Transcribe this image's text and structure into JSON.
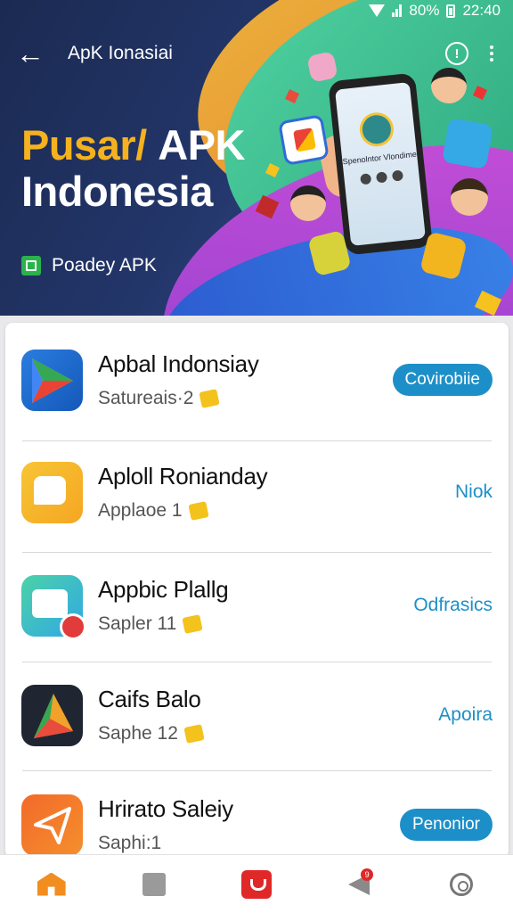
{
  "status": {
    "battery": "80%",
    "time": "22:40"
  },
  "topbar": {
    "title": "ApK Ionasiai"
  },
  "hero": {
    "title_part1": "Pusar/",
    "title_part2": "APK",
    "title_line2": "Indonesia",
    "subtitle": "Poadey APK",
    "phone_screen_text": "Spenolntor Vlondime"
  },
  "apps": [
    {
      "name": "Apbal Indonsiay",
      "sub": "Satureais·2",
      "action": "Covirobiie",
      "action_style": "pill"
    },
    {
      "name": "Aploll Ronianday",
      "sub": "Applaoe 1",
      "action": "Niok",
      "action_style": "text"
    },
    {
      "name": "Appbic Plallg",
      "sub": "Sapler 11",
      "action": "Odfrasics",
      "action_style": "text"
    },
    {
      "name": "Caifs Balo",
      "sub": "Saphe 12",
      "action": "Apoira",
      "action_style": "text"
    },
    {
      "name": "Hrirato Saleiy",
      "sub": "Saphi:1",
      "action": "Penonior",
      "action_style": "pill"
    }
  ],
  "bottom_nav": {
    "items": [
      {
        "icon": "home-icon"
      },
      {
        "icon": "square-icon"
      },
      {
        "icon": "store-icon"
      },
      {
        "icon": "send-icon",
        "badge": "9"
      },
      {
        "icon": "settings-icon"
      }
    ]
  },
  "colors": {
    "accent": "#1d8fc8",
    "title_yellow": "#f5b21e",
    "hero_bg": "#23366a",
    "nav_active": "#f28d1f"
  }
}
